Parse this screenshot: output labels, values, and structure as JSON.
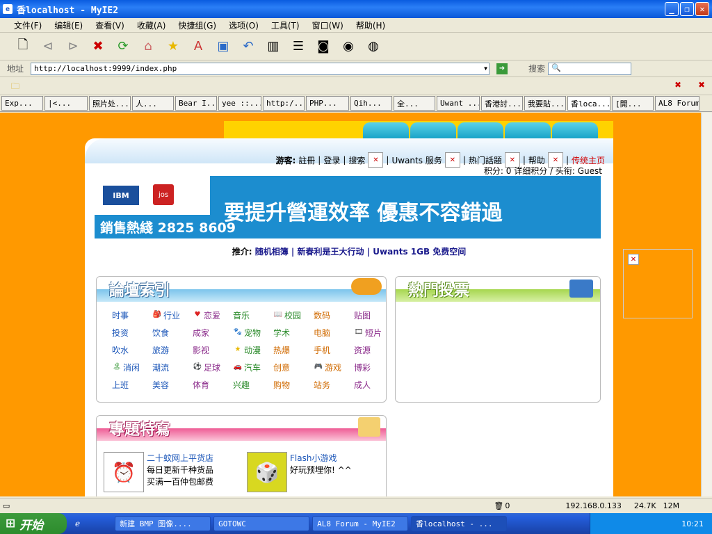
{
  "window": {
    "title": "香localhost - MyIE2"
  },
  "menu": [
    "文件(F)",
    "编辑(E)",
    "查看(V)",
    "收藏(A)",
    "快捷组(G)",
    "选项(O)",
    "工具(T)",
    "窗口(W)",
    "帮助(H)"
  ],
  "address": {
    "label": "地址",
    "url": "http://localhost:9999/index.php",
    "search_label": "搜索"
  },
  "tabs": [
    "Exp...",
    "|<...",
    "照片处...",
    "人...",
    "Bear I...",
    "yee ::...",
    "http:/...",
    "PHP...",
    "Qih...",
    "全...",
    "Uwant ...",
    "香港討...",
    "我要貼...",
    "香loca...",
    "[開...",
    "AL8 Forum"
  ],
  "page": {
    "toplinks": {
      "guest": "游客:",
      "register": "註冊",
      "login": "登录",
      "search": "搜索",
      "service": "Uwants 服务",
      "hot": "热门話題",
      "help": "帮助",
      "home": "传统主页"
    },
    "userinfo": "积分: 0 详细积分 / 头衔: Guest",
    "banner": {
      "ibm": "IBM",
      "jos": "jos",
      "hotline": "銷售熱綫 2825 8609",
      "slogan": "要提升營運效率 優惠不容錯過"
    },
    "promo": {
      "label": "推介:",
      "l1": "随机相簿",
      "l2": "新春利是王大行动",
      "l3": "Uwants 1GB 免费空间"
    },
    "forum_title": "論壇索引",
    "vote_title": "熱門投票",
    "special_title": "專題特寫",
    "forum_cells": [
      "时事",
      "行业",
      "恋爱",
      "音乐",
      "校园",
      "数码",
      "贴图",
      "投资",
      "饮食",
      "成家",
      "宠物",
      "学术",
      "电脑",
      "短片",
      "吹水",
      "旅游",
      "影视",
      "动漫",
      "热爆",
      "手机",
      "资源",
      "消闲",
      "潮流",
      "足球",
      "汽车",
      "创意",
      "游戏",
      "博彩",
      "上班",
      "美容",
      "体育",
      "兴趣",
      "购物",
      "站务",
      "成人"
    ],
    "special": [
      {
        "title": "二十蚊网上平货店",
        "line1": "每日更新千种货品",
        "line2": "买满一百仲包邮费"
      },
      {
        "title": "Flash小游戏",
        "line1": "好玩预埋你! ^^",
        "line2": ""
      }
    ]
  },
  "status": {
    "ip": "192.168.0.133",
    "size": "24.7K",
    "mem": "12M",
    "count": "0"
  },
  "taskbar": {
    "start": "开始",
    "tasks": [
      "新建 BMP 图像....",
      "GOTOWC",
      "AL8 Forum - MyIE2",
      "香localhost - ..."
    ],
    "clock": "10:21"
  }
}
